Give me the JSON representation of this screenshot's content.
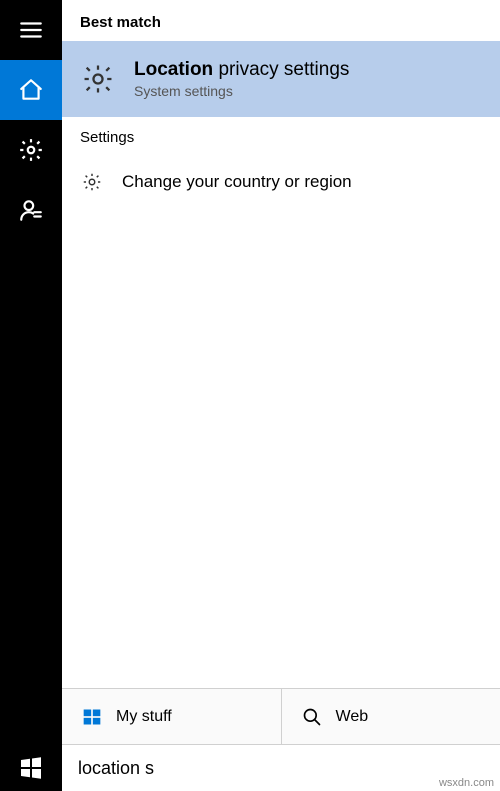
{
  "headers": {
    "best_match": "Best match",
    "settings": "Settings"
  },
  "best_result": {
    "title_bold": "Location",
    "title_rest": " privacy settings",
    "subtitle": "System settings",
    "icon": "gear-icon"
  },
  "settings_results": [
    {
      "title": "Change your country or region",
      "icon": "gear-icon"
    }
  ],
  "filters": {
    "mystuff": "My stuff",
    "web": "Web"
  },
  "search": {
    "value": "location s",
    "placeholder": ""
  },
  "watermark": "wsxdn.com"
}
